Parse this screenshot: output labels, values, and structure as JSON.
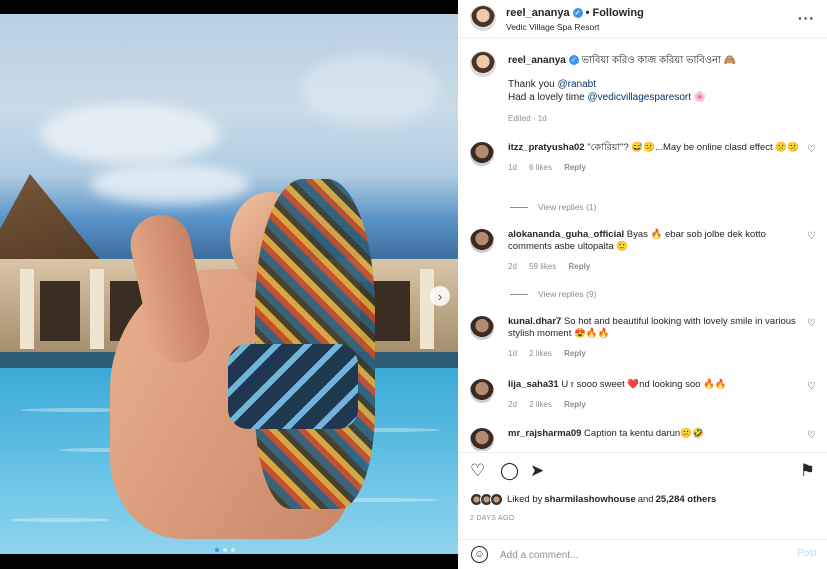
{
  "header": {
    "username": "reel_ananya",
    "separator": "•",
    "follow_status": "Following",
    "location": "Vedic Village Spa Resort",
    "more_icon": "more-horizontal-icon"
  },
  "caption": {
    "username": "reel_ananya",
    "title_text": "ভাবিয়া করিও কাজ করিয়া ভাবিওনা 🙈",
    "line1_prefix": "Thank you ",
    "line1_mention": "@ranabt",
    "line2_prefix": "Had a lovely time ",
    "line2_mention": "@vedicvillagesparesort",
    "line2_suffix": " 🌸",
    "meta": "Edited · 1d"
  },
  "comments": [
    {
      "username": "itzz_pratyusha02",
      "text": " \"কোরিয়া\"? 😅😕...May be online clasd effect 😕😕",
      "time": "1d",
      "likes": "6 likes",
      "reply": "Reply",
      "view_replies": "View replies (1)"
    },
    {
      "username": "alokananda_guha_official",
      "text": " Byas 🔥 ebar sob jolbe dek kotto comments asbe ultopalta 🙂",
      "time": "2d",
      "likes": "59 likes",
      "reply": "Reply",
      "view_replies": "View replies (9)"
    },
    {
      "username": "kunal.dhar7",
      "text": " So hot and beautiful looking with lovely smile in various stylish moment 😍🔥🔥",
      "time": "1d",
      "likes": "2 likes",
      "reply": "Reply"
    },
    {
      "username": "lija_saha31",
      "text": " U r sooo sweet ❤️nd looking soo 🔥🔥",
      "time": "2d",
      "likes": "2 likes",
      "reply": "Reply"
    },
    {
      "username": "mr_rajsharma09",
      "text": " Caption ta kentu darun😕🤣"
    }
  ],
  "actions": {
    "like_icon": "heart-icon",
    "comment_icon": "comment-icon",
    "share_icon": "send-icon",
    "save_icon": "bookmark-icon",
    "liked_by_prefix": "Liked by ",
    "liked_by_user": "sharmilashowhouse",
    "liked_by_mid": " and ",
    "liked_by_count": "25,284 others",
    "date": "2 DAYS AGO"
  },
  "add_comment": {
    "placeholder": "Add a comment...",
    "post_label": "Post"
  },
  "colors": {
    "link": "#00376b",
    "verified": "#3897f0",
    "post_disabled": "#b2dffc"
  }
}
